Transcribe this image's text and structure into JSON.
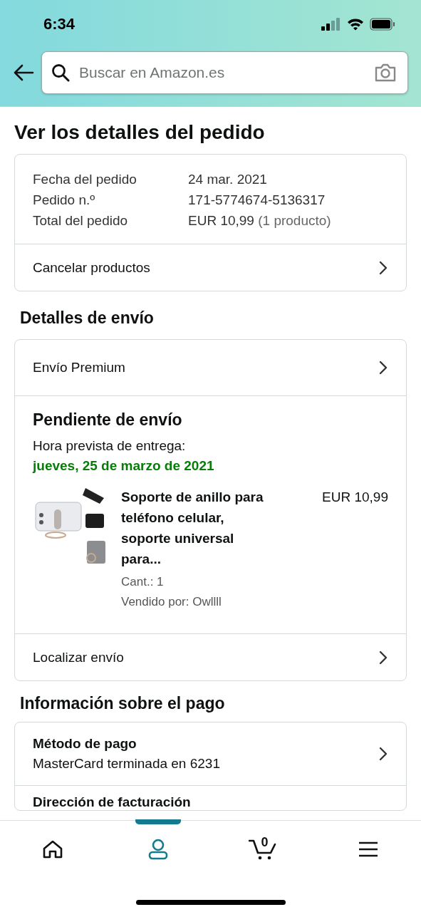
{
  "status_bar": {
    "time": "6:34"
  },
  "search": {
    "placeholder": "Buscar en Amazon.es"
  },
  "title": "Ver los detalles del pedido",
  "summary": {
    "rows": [
      {
        "label": "Fecha del pedido",
        "value": "24 mar. 2021"
      },
      {
        "label": "Pedido n.º",
        "value": "171-5774674-5136317"
      },
      {
        "label": "Total del pedido",
        "value": "EUR 10,99",
        "note": "(1 producto)"
      }
    ],
    "link": "Cancelar productos"
  },
  "shipping": {
    "heading": "Detalles de envío",
    "method": "Envío Premium",
    "status": "Pendiente de envío",
    "eta_label": "Hora prevista de entrega:",
    "eta": "jueves, 25 de marzo de 2021",
    "item": {
      "kind": "picture",
      "title": "Soporte de anillo para teléfono celular, soporte universal para...",
      "price": "EUR 10,99",
      "quantity": "Cant.: 1",
      "seller": "Vendido por: Owllll"
    },
    "link": "Localizar envío"
  },
  "payment": {
    "heading": "Información sobre el pago",
    "method_label": "Método de pago",
    "method": "MasterCard terminada en 6231",
    "next": "Dirección de facturación"
  },
  "nav": [
    {
      "kind": "home",
      "selected": false
    },
    {
      "kind": "account",
      "selected": true
    },
    {
      "kind": "cart",
      "count": "0",
      "selected": false
    },
    {
      "kind": "menu",
      "selected": false
    }
  ]
}
